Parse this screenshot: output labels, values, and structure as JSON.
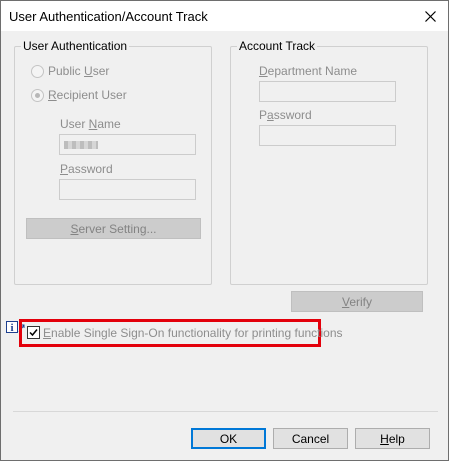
{
  "window": {
    "title": "User Authentication/Account Track"
  },
  "user_auth": {
    "legend": "User Authentication",
    "public_user_label": "Public User",
    "recipient_user_label": "Recipient User",
    "selected": "Recipient User",
    "user_name_label": "User Name",
    "password_label": "Password",
    "server_setting_label": "Server Setting..."
  },
  "account_track": {
    "legend": "Account Track",
    "department_name_label": "Department Name",
    "password_label": "Password"
  },
  "verify_label": "Verify",
  "sso": {
    "label": "Enable Single Sign-On functionality for printing functions",
    "checked": true
  },
  "buttons": {
    "ok": "OK",
    "cancel": "Cancel",
    "help": "Help"
  },
  "colors": {
    "highlight": "#e3000b",
    "default_button_border": "#0078d7"
  }
}
